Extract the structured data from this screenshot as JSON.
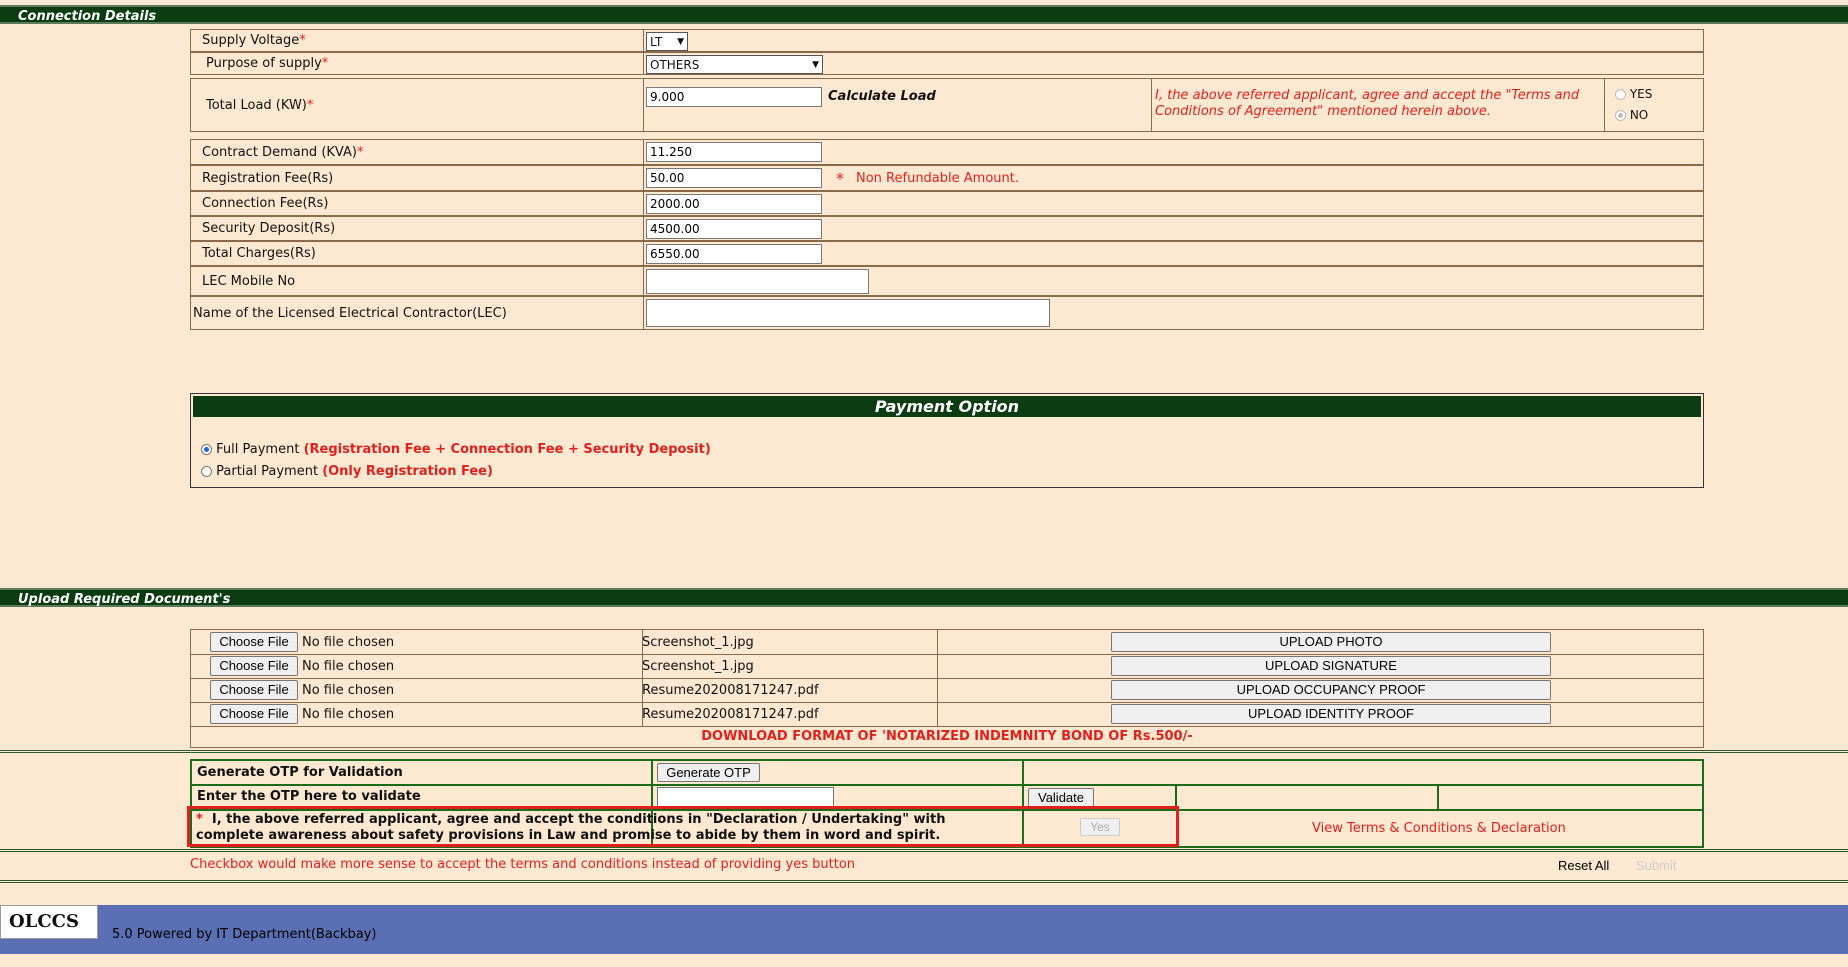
{
  "sections": {
    "connection_details": "Connection Details",
    "upload_docs": "Upload Required Document's",
    "payment_option": "Payment Option"
  },
  "form": {
    "supply_voltage_label": "Supply Voltage",
    "supply_voltage_value": "LT",
    "purpose_label": "Purpose of supply",
    "purpose_value": "OTHERS",
    "total_load_label": "Total Load (KW)",
    "total_load_value": "9.000",
    "calculate_load": "Calculate Load",
    "agreement_text": "I, the above referred applicant, agree and accept the \"Terms and Conditions of Agreement\" mentioned herein above.",
    "yes_label": "YES",
    "no_label": "NO",
    "required_mark": "*",
    "contract_demand_label": "Contract Demand (KVA)",
    "contract_demand_value": "11.250",
    "registration_fee_label": "Registration Fee(Rs)",
    "registration_fee_value": "50.00",
    "non_refundable": "Non Refundable Amount.",
    "connection_fee_label": "Connection Fee(Rs)",
    "connection_fee_value": "2000.00",
    "security_deposit_label": "Security Deposit(Rs)",
    "security_deposit_value": "4500.00",
    "total_charges_label": "Total Charges(Rs)",
    "total_charges_value": "6550.00",
    "lec_mobile_label": "LEC Mobile No",
    "lec_mobile_value": "",
    "lec_name_label": "Name of the Licensed Electrical Contractor(LEC)",
    "lec_name_value": ""
  },
  "payment": {
    "full_label": "Full Payment",
    "full_note": "(Registration Fee + Connection Fee + Security Deposit)",
    "partial_label": "Partial Payment",
    "partial_note": "(Only Registration Fee)"
  },
  "uploads": [
    {
      "choose": "Choose File",
      "status": "No file chosen",
      "file": "Screenshot_1.jpg",
      "button": "UPLOAD PHOTO"
    },
    {
      "choose": "Choose File",
      "status": "No file chosen",
      "file": "Screenshot_1.jpg",
      "button": "UPLOAD SIGNATURE"
    },
    {
      "choose": "Choose File",
      "status": "No file chosen",
      "file": "Resume202008171247.pdf",
      "button": "UPLOAD OCCUPANCY PROOF"
    },
    {
      "choose": "Choose File",
      "status": "No file chosen",
      "file": "Resume202008171247.pdf",
      "button": "UPLOAD IDENTITY PROOF"
    }
  ],
  "download_link": "DOWNLOAD FORMAT OF 'NOTARIZED INDEMNITY BOND OF Rs.500/-",
  "otp": {
    "generate_label": "Generate OTP for Validation",
    "generate_button": "Generate OTP",
    "enter_label": "Enter the OTP here to validate",
    "otp_value": "",
    "validate_button": "Validate",
    "declaration_star": "*",
    "declaration": "I, the above referred applicant, agree and accept the conditions in \"Declaration / Undertaking\" with complete awareness about safety provisions in Law and promise to abide by them in word and spirit.",
    "yes_button": "Yes",
    "view_terms": "View Terms & Conditions & Declaration"
  },
  "annotation": "Checkbox would make more sense to accept the terms and conditions instead of providing yes button",
  "actions": {
    "reset": "Reset All",
    "submit": "Submit"
  },
  "footer": {
    "logo": "OLCCS",
    "powered": "5.0 Powered by IT Department(Backbay)"
  },
  "colors": {
    "header_green": "#0c3c12",
    "page_bg": "#fde9d1",
    "footer_blue": "#5b6fb4",
    "required_red": "#e0201c",
    "highlight_box": "#e0201c"
  }
}
